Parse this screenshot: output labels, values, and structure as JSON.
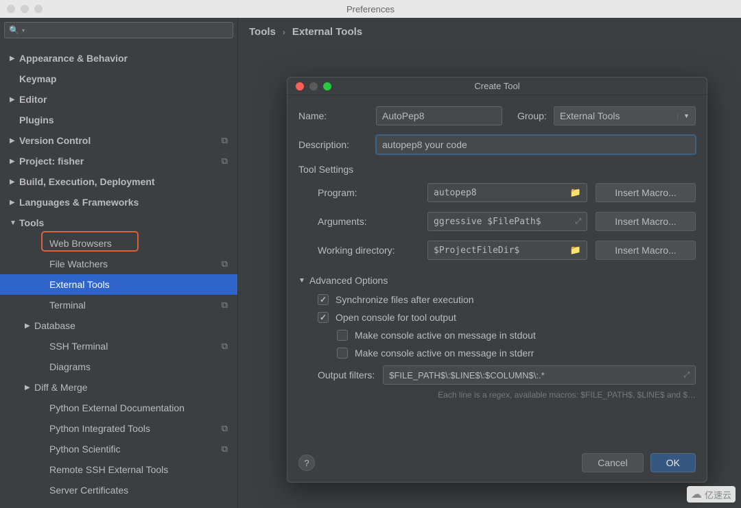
{
  "window": {
    "title": "Preferences"
  },
  "search": {
    "placeholder": ""
  },
  "sidebar": {
    "items": [
      {
        "label": "Appearance & Behavior",
        "arrow": "▶",
        "indent": 0
      },
      {
        "label": "Keymap",
        "arrow": "",
        "indent": 0
      },
      {
        "label": "Editor",
        "arrow": "▶",
        "indent": 0
      },
      {
        "label": "Plugins",
        "arrow": "",
        "indent": 0
      },
      {
        "label": "Version Control",
        "arrow": "▶",
        "indent": 0,
        "copy": true
      },
      {
        "label": "Project: fisher",
        "arrow": "▶",
        "indent": 0,
        "copy": true
      },
      {
        "label": "Build, Execution, Deployment",
        "arrow": "▶",
        "indent": 0
      },
      {
        "label": "Languages & Frameworks",
        "arrow": "▶",
        "indent": 0
      },
      {
        "label": "Tools",
        "arrow": "▼",
        "indent": 0
      },
      {
        "label": "Web Browsers",
        "arrow": "",
        "indent": 2
      },
      {
        "label": "File Watchers",
        "arrow": "",
        "indent": 2,
        "copy": true
      },
      {
        "label": "External Tools",
        "arrow": "",
        "indent": 2,
        "selected": true,
        "highlight": true
      },
      {
        "label": "Terminal",
        "arrow": "",
        "indent": 2,
        "copy": true
      },
      {
        "label": "Database",
        "arrow": "▶",
        "indent": 1
      },
      {
        "label": "SSH Terminal",
        "arrow": "",
        "indent": 2,
        "copy": true
      },
      {
        "label": "Diagrams",
        "arrow": "",
        "indent": 2
      },
      {
        "label": "Diff & Merge",
        "arrow": "▶",
        "indent": 1
      },
      {
        "label": "Python External Documentation",
        "arrow": "",
        "indent": 2
      },
      {
        "label": "Python Integrated Tools",
        "arrow": "",
        "indent": 2,
        "copy": true
      },
      {
        "label": "Python Scientific",
        "arrow": "",
        "indent": 2,
        "copy": true
      },
      {
        "label": "Remote SSH External Tools",
        "arrow": "",
        "indent": 2
      },
      {
        "label": "Server Certificates",
        "arrow": "",
        "indent": 2
      }
    ]
  },
  "breadcrumb": {
    "root": "Tools",
    "sep": "›",
    "leaf": "External Tools"
  },
  "dialog": {
    "title": "Create Tool",
    "name_label": "Name:",
    "name_value": "AutoPep8",
    "group_label": "Group:",
    "group_value": "External Tools",
    "desc_label": "Description:",
    "desc_value": "autopep8 your code",
    "tool_settings": "Tool Settings",
    "program_label": "Program:",
    "program_value": "autopep8",
    "arguments_label": "Arguments:",
    "arguments_value": "ggressive $FilePath$",
    "workdir_label": "Working directory:",
    "workdir_value": "$ProjectFileDir$",
    "macro_btn": "Insert Macro...",
    "adv_header": "Advanced Options",
    "cb_sync": "Synchronize files after execution",
    "cb_console": "Open console for tool output",
    "cb_stdout": "Make console active on message in stdout",
    "cb_stderr": "Make console active on message in stderr",
    "output_label": "Output filters:",
    "output_value": "$FILE_PATH$\\:$LINE$\\:$COLUMN$\\:.*",
    "hint": "Each line is a regex, available macros: $FILE_PATH$, $LINE$ and $…",
    "cancel": "Cancel",
    "ok": "OK",
    "help": "?"
  },
  "watermark": "亿速云"
}
